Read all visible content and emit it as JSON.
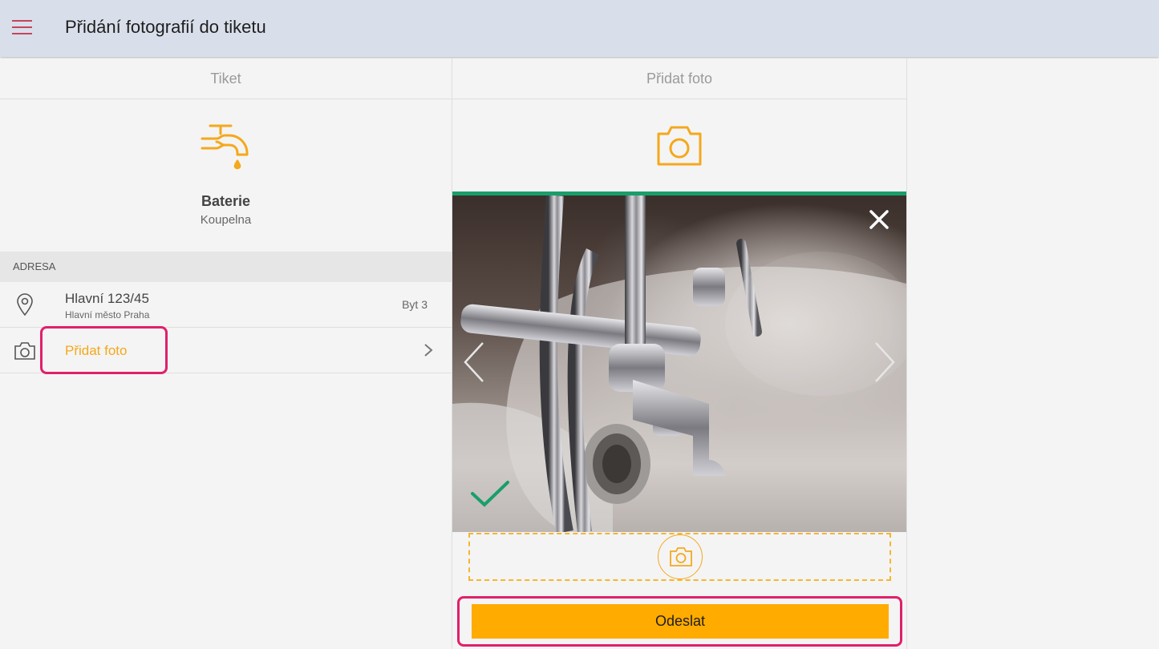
{
  "header": {
    "title": "Přidání fotografií do tiketu"
  },
  "left_panel": {
    "tab_title": "Tiket",
    "ticket": {
      "name": "Baterie",
      "location": "Koupelna",
      "icon": "faucet-icon"
    },
    "section_label": "ADRESA",
    "address": {
      "street": "Hlavní 123/45",
      "city": "Hlavní město Praha",
      "unit": "Byt 3"
    },
    "add_photo_label": "Přidat foto"
  },
  "right_panel": {
    "tab_title": "Přidat foto",
    "send_label": "Odeslat"
  },
  "colors": {
    "accent": "#f5a81c",
    "send_button": "#ffab00",
    "header_bg": "#d9dfea",
    "success": "#1a9e6a",
    "highlight": "#e0206a"
  }
}
